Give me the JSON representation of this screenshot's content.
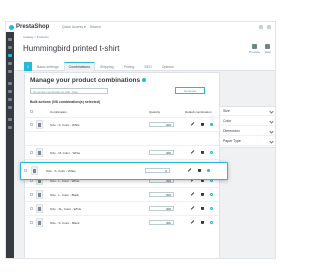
{
  "app": {
    "logo": "PrestaShop"
  },
  "topbar": {
    "shop_selector": "Quick Access ▾",
    "search_placeholder": "Search"
  },
  "header": {
    "breadcrumb": "Catalog > Products",
    "title": "Hummingbird printed t-shirt",
    "actions": [
      {
        "label": "Preview"
      },
      {
        "label": "Help"
      }
    ]
  },
  "tabs": [
    {
      "label": "1",
      "active": false
    },
    {
      "label": "Basic settings",
      "active": false
    },
    {
      "label": "Combinations",
      "active": true
    },
    {
      "label": "Shipping",
      "active": false
    },
    {
      "label": "Pricing",
      "active": false
    },
    {
      "label": "SEO",
      "active": false
    },
    {
      "label": "Options",
      "active": false
    }
  ],
  "card": {
    "title": "Manage your product combinations",
    "search_placeholder": "Generate combinations with: Size",
    "generate_button": "Generate",
    "bulk_actions": "Bulk actions (0/8 combination(s) selected)",
    "columns": {
      "combination": "Combination",
      "quantity": "Quantity",
      "default": "Default combination"
    }
  },
  "rows": [
    {
      "name": "Size - S, Color - White",
      "qty": "300",
      "default": true
    },
    {
      "name": "Size - S, Color - Black",
      "qty": "300",
      "default": false
    },
    {
      "name": "Size - M, Color - White",
      "qty": "300",
      "default": false
    },
    {
      "name": "Size - M, Color - Black",
      "qty": "300",
      "default": false
    },
    {
      "name": "Size - L, Color - White",
      "qty": "300",
      "default": false
    },
    {
      "name": "Size - L, Color - Black",
      "qty": "300",
      "default": false
    },
    {
      "name": "Size - XL, Color - White",
      "qty": "300",
      "default": false
    }
  ],
  "highlighted_row": {
    "name": "Size - S, Color - White",
    "qty": "0"
  },
  "filters": [
    {
      "label": "Size"
    },
    {
      "label": "Color"
    },
    {
      "label": "Dimension"
    },
    {
      "label": "Paper Type"
    }
  ],
  "colors": {
    "accent": "#25b9d7",
    "sidebar": "#363a41"
  }
}
